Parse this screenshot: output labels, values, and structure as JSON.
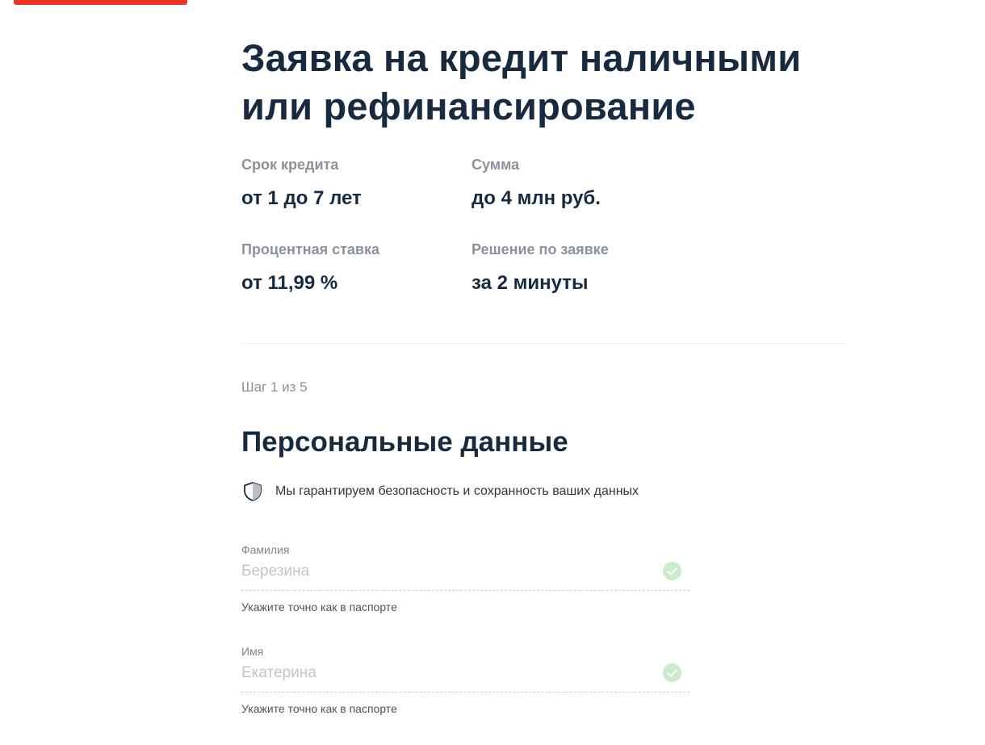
{
  "header": {
    "accent_color": "#ef3124"
  },
  "page": {
    "title_line1": "Заявка на кредит наличными",
    "title_line2": "или рефинансирование"
  },
  "params": [
    {
      "label": "Срок кредита",
      "value": "от 1 до 7 лет"
    },
    {
      "label": "Сумма",
      "value": "до 4 млн руб."
    },
    {
      "label": "Процентная ставка",
      "value": "от 11,99 %"
    },
    {
      "label": "Решение по заявке",
      "value": "за 2 минуты"
    }
  ],
  "form": {
    "step": "Шаг 1 из 5",
    "section_title": "Персональные данные",
    "security_icon": "shield-icon",
    "security_text": "Мы гарантируем безопасность и сохранность ваших данных",
    "fields": [
      {
        "label": "Фамилия",
        "value": "Березина",
        "hint": "Укажите точно как в паспорте",
        "status_icon": "check-circle-icon"
      },
      {
        "label": "Имя",
        "value": "Екатерина",
        "hint": "Укажите точно как в паспорте",
        "status_icon": "check-circle-icon"
      }
    ]
  },
  "colors": {
    "heading": "#172a3f",
    "muted": "#8a929b",
    "valid_check_bg": "#c8eccd"
  }
}
